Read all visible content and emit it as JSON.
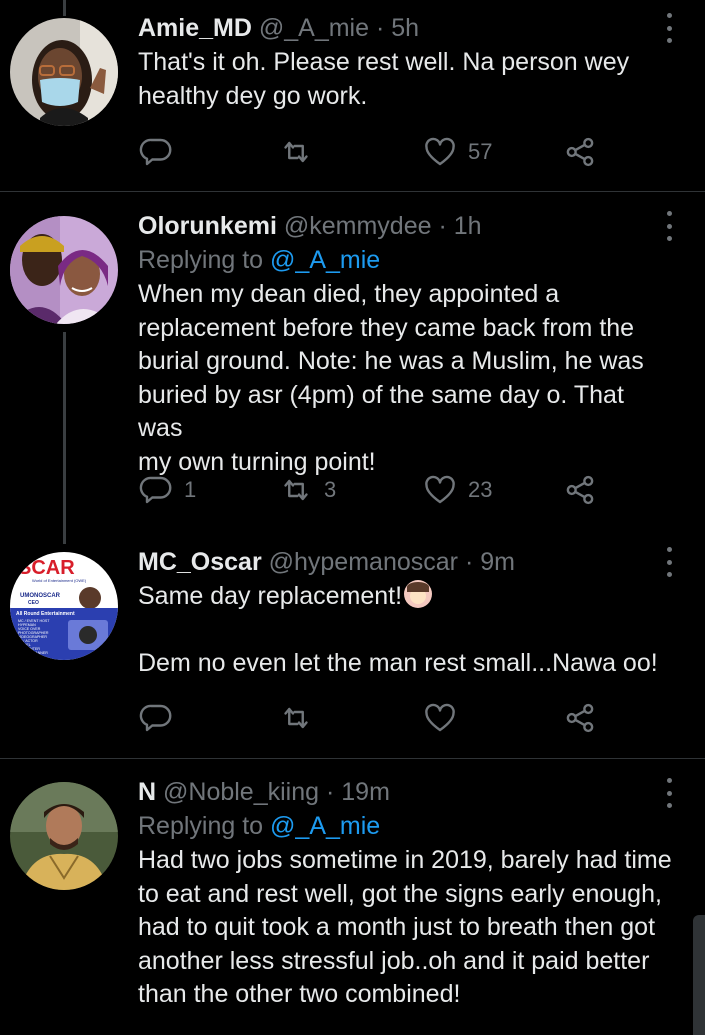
{
  "tweets": [
    {
      "name": "Amie_MD",
      "handle": "@_A_mie",
      "time": "· 5h",
      "replying_prefix": "",
      "replying_to": "",
      "lines": [
        "That's it oh. Please rest well. Na person wey",
        "healthy dey go work."
      ],
      "reply_count": "",
      "retweet_count": "",
      "like_count": "57"
    },
    {
      "name": "Olorunkemi",
      "handle": "@kemmydee",
      "time": "· 1h",
      "replying_prefix": "Replying to",
      "replying_to": "@_A_mie",
      "lines": [
        "When my dean died, they appointed a",
        "replacement before they came back from the",
        "burial ground. Note: he was a Muslim, he was",
        "buried by asr (4pm) of the same day o. That was",
        "my own turning point!"
      ],
      "reply_count": "1",
      "retweet_count": "3",
      "like_count": "23"
    },
    {
      "name": "MC_Oscar",
      "handle": "@hypemanoscar",
      "time": "· 9m",
      "replying_prefix": "",
      "replying_to": "",
      "lines": [
        "Same day replacement!",
        "Dem no even let the man rest small...Nawa oo!"
      ],
      "reply_count": "",
      "retweet_count": "",
      "like_count": ""
    },
    {
      "name": "N",
      "handle": "@Noble_kiing",
      "time": "· 19m",
      "replying_prefix": "Replying to",
      "replying_to": "@_A_mie",
      "lines": [
        "Had two jobs sometime in 2019, barely had time",
        "to eat and rest well, got the signs early enough,",
        "had to quit took a month just to breath then got",
        "another less stressful job..oh and it paid better",
        "than the other two combined!"
      ],
      "reply_count": "",
      "retweet_count": "",
      "like_count": ""
    }
  ],
  "avatar_logo_text": {
    "brand": "SCAR",
    "tagline": "World of Entertainment (OWE)",
    "name_line": "UMONOSCAR",
    "title_line": "CEO",
    "banner": "All Round Entertainment",
    "services": [
      "MC / EVENT HOST",
      "HYPEMAN",
      "VOICE OVER",
      "PHOTOGRAPHER",
      "VIDEOGRAPHER",
      "DJ / ACTOR",
      "MODEL",
      "PRESENTER",
      "EVENT PLANNER"
    ]
  },
  "icons": {
    "reply": "reply-bubble-icon",
    "retweet": "retweet-icon",
    "like": "heart-icon",
    "share": "share-icon",
    "more": "more-vertical-icon"
  },
  "colors": {
    "background": "#000000",
    "text": "#e7e9ea",
    "muted": "#71767b",
    "link": "#1d9bf0",
    "divider": "#2f3336"
  }
}
